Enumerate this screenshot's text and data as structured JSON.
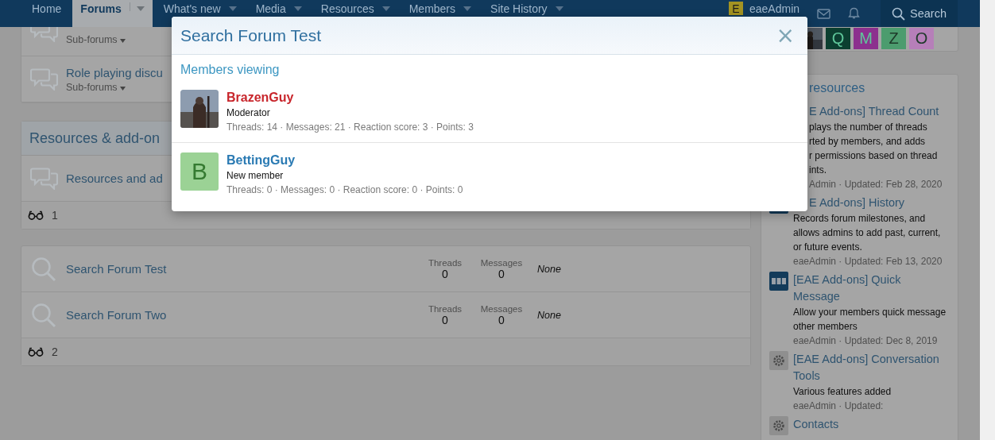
{
  "nav": {
    "items": [
      {
        "label": "Home",
        "selected": false,
        "has_menu": false
      },
      {
        "label": "Forums",
        "selected": true,
        "has_menu": true
      },
      {
        "label": "What's new",
        "selected": false,
        "has_menu": true
      },
      {
        "label": "Media",
        "selected": false,
        "has_menu": true
      },
      {
        "label": "Resources",
        "selected": false,
        "has_menu": true
      },
      {
        "label": "Members",
        "selected": false,
        "has_menu": true
      },
      {
        "label": "Site History",
        "selected": false,
        "has_menu": true
      }
    ],
    "user": {
      "avatar_letter": "E",
      "name": "eaeAdmin"
    },
    "search_label": "Search"
  },
  "forum_blocks": [
    {
      "nodes": [
        {
          "kind": "category",
          "subforums": "Sub-forums"
        },
        {
          "kind": "category",
          "title": "Role playing discu",
          "subforums": "Sub-forums"
        }
      ]
    },
    {
      "title": "Resources & add-on",
      "nodes": [
        {
          "kind": "category",
          "title": "Resources and ad"
        }
      ],
      "footer": "1"
    },
    {
      "nodes": [
        {
          "kind": "search",
          "title": "Search Forum Test",
          "threads_label": "Threads",
          "threads": "0",
          "messages_label": "Messages",
          "messages": "0",
          "last_post": "None"
        },
        {
          "kind": "search",
          "title": "Search Forum Two",
          "threads_label": "Threads",
          "threads": "0",
          "messages_label": "Messages",
          "messages": "0",
          "last_post": "None"
        }
      ],
      "footer": "2"
    }
  ],
  "sidebar": {
    "online_avatars": [
      {
        "kind": "picture"
      },
      {
        "kind": "letter",
        "letter": "Q",
        "color": "#0c3f30"
      },
      {
        "kind": "letter",
        "letter": "M",
        "color": "#8c308e"
      },
      {
        "kind": "letter",
        "letter": "Z",
        "color": "#4c9c6e"
      },
      {
        "kind": "letter",
        "letter": "O",
        "color": "#b67fb9"
      }
    ],
    "resources": {
      "title": "resources",
      "title_covered": true,
      "items": [
        {
          "kind": "covered",
          "title": "E Add-ons] Thread Count",
          "title_covered": true,
          "description_lines": [
            "plays the number of threads",
            "rted by members, and adds",
            "r permissions based on thread",
            "ints."
          ],
          "meta": "Admin · Updated: Feb 28, 2020"
        },
        {
          "kind": "logo",
          "title": "E Add-ons] History",
          "title_covered": true,
          "description": "Records forum milestones, and allows admins to add past, current, or future events.",
          "meta": "eaeAdmin · Updated: Feb 13, 2020"
        },
        {
          "kind": "logo",
          "title": "[EAE Add-ons] Quick Message",
          "title_covered": false,
          "description": "Allow your members quick message other members",
          "meta": "eaeAdmin · Updated: Dec 8, 2019"
        },
        {
          "kind": "gear",
          "title": "[EAE Add-ons] Conversation Tools",
          "title_covered": false,
          "description": "Various features added",
          "meta": "eaeAdmin · Updated:"
        },
        {
          "kind": "gear",
          "title": "Contacts",
          "title_covered": false
        }
      ]
    }
  },
  "modal": {
    "title": "Search Forum Test",
    "close": "×",
    "section_title": "Members viewing",
    "members": [
      {
        "kind": "picture",
        "name": "BrazenGuy",
        "color": "#c8262c",
        "role": "Moderator",
        "stats": "Threads: 14 · Messages: 21 · Reaction score: 3 · Points: 3"
      },
      {
        "kind": "letter",
        "letter": "B",
        "name": "BettingGuy",
        "color": "#2a7ab3",
        "role": "New member",
        "stats": "Threads: 0 · Messages: 0 · Reaction score: 0 · Points: 0"
      }
    ]
  }
}
